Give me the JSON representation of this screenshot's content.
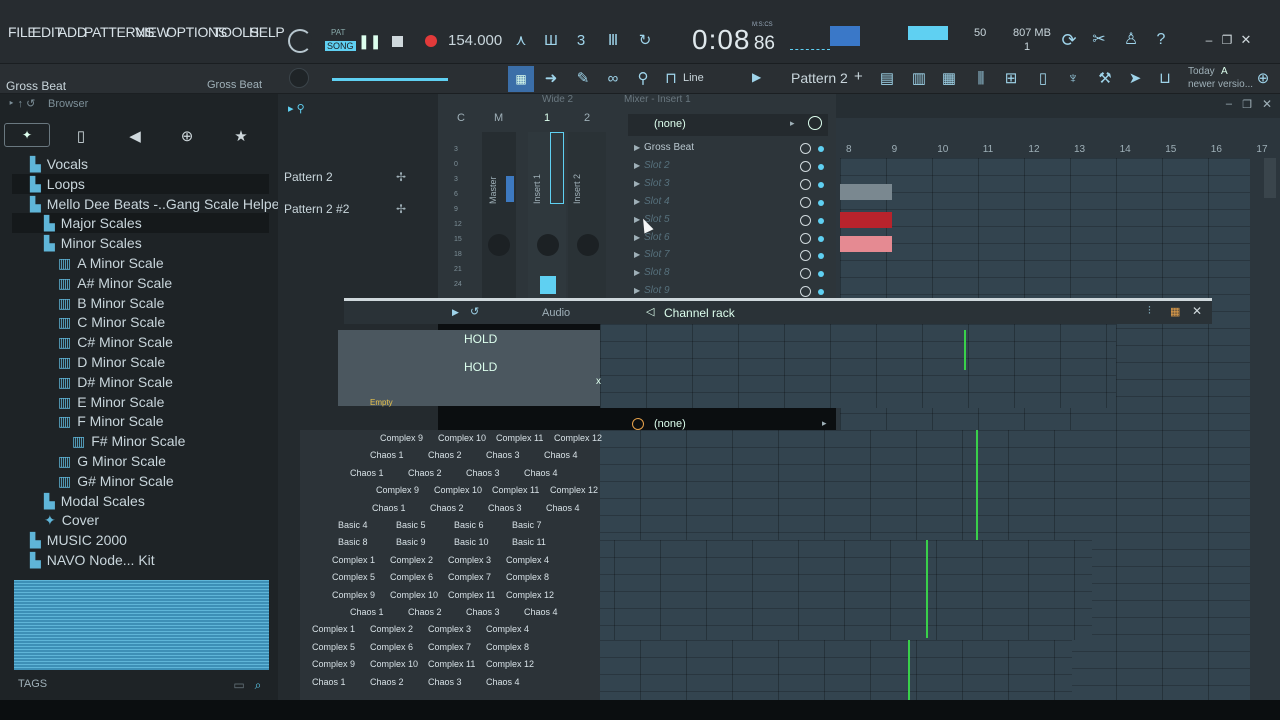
{
  "menu": [
    "FILE",
    "EDIT",
    "ADD",
    "PATTERNS",
    "VIEW",
    "OPTIONS",
    "TOOLS",
    "HELP"
  ],
  "transport": {
    "mode_pat": "PAT",
    "mode_song": "SONG",
    "tempo": "154.000",
    "time": "0:08",
    "time_sub": "86",
    "time_unit": "M:S:CS",
    "cpu_value": "50",
    "memory": "807 MB",
    "voices": "1"
  },
  "hint": {
    "left": "Gross Beat",
    "right": "Gross Beat"
  },
  "toolbar2": {
    "snap": "Line",
    "pattern": "Pattern 2",
    "news_date": "Today",
    "news_letter": "A",
    "news_text": "newer versio..."
  },
  "browser": {
    "title": "Browser",
    "items": [
      {
        "label": "Vocals",
        "indent": 1,
        "icon": "folder"
      },
      {
        "label": "Loops",
        "indent": 1,
        "icon": "folder"
      },
      {
        "label": "Mello Dee Beats -..Gang Scale Helpers",
        "indent": 1,
        "icon": "folder"
      },
      {
        "label": "Major Scales",
        "indent": 2,
        "icon": "folder"
      },
      {
        "label": "Minor Scales",
        "indent": 2,
        "icon": "folder"
      },
      {
        "label": "A Minor Scale",
        "indent": 3,
        "icon": "piano"
      },
      {
        "label": "A# Minor Scale",
        "indent": 3,
        "icon": "piano"
      },
      {
        "label": "B Minor Scale",
        "indent": 3,
        "icon": "piano"
      },
      {
        "label": "C Minor Scale",
        "indent": 3,
        "icon": "piano"
      },
      {
        "label": "C# Minor Scale",
        "indent": 3,
        "icon": "piano"
      },
      {
        "label": "D Minor Scale",
        "indent": 3,
        "icon": "piano"
      },
      {
        "label": "D# Minor Scale",
        "indent": 3,
        "icon": "piano"
      },
      {
        "label": "E Minor Scale",
        "indent": 3,
        "icon": "piano"
      },
      {
        "label": "F Minor Scale",
        "indent": 3,
        "icon": "piano"
      },
      {
        "label": "F# Minor Scale",
        "indent": 4,
        "icon": "piano"
      },
      {
        "label": "G Minor Scale",
        "indent": 3,
        "icon": "piano"
      },
      {
        "label": "G# Minor Scale",
        "indent": 3,
        "icon": "piano"
      },
      {
        "label": "Modal Scales",
        "indent": 2,
        "icon": "folder"
      },
      {
        "label": "Cover",
        "indent": 2,
        "icon": "pin"
      },
      {
        "label": "MUSIC 2000",
        "indent": 1,
        "icon": "folder"
      },
      {
        "label": "NAVO Node... Kit",
        "indent": 1,
        "icon": "folder"
      }
    ],
    "tags_label": "TAGS"
  },
  "patterns": [
    "Pattern 2",
    "Pattern 2 #2"
  ],
  "mixer": {
    "title": "Mixer - Insert 1",
    "wide": "Wide 2",
    "cols": [
      "C",
      "M",
      "1",
      "2"
    ],
    "tracks": [
      "Master",
      "Insert 1",
      "Insert 2"
    ],
    "none_label": "(none)",
    "slots": [
      "Gross Beat",
      "Slot 2",
      "Slot 3",
      "Slot 4",
      "Slot 5",
      "Slot 6",
      "Slot 7",
      "Slot 8",
      "Slot 9"
    ],
    "vu_marks": [
      "3",
      "0",
      "3",
      "6",
      "9",
      "12",
      "15",
      "18",
      "21",
      "24"
    ]
  },
  "playlist": {
    "bars": [
      "8",
      "9",
      "10",
      "11",
      "12",
      "13",
      "14",
      "15",
      "16",
      "17"
    ]
  },
  "channel_rack": {
    "title": "Channel rack",
    "filter": "Audio",
    "none_label": "(none)",
    "hold": "HOLD",
    "empty": "Empty",
    "close": "x"
  },
  "presets": [
    [
      "Complex 9",
      "Complex 10",
      "Complex 11",
      "Complex 12"
    ],
    [
      "Chaos 1",
      "Chaos 2",
      "Chaos 3",
      "Chaos 4"
    ],
    [
      "Chaos 1",
      "Chaos 2",
      "Chaos 3",
      "Chaos 4"
    ],
    [
      "Complex 9",
      "Complex 10",
      "Complex 11",
      "Complex 12"
    ],
    [
      "Chaos 1",
      "Chaos 2",
      "Chaos 3",
      "Chaos 4"
    ],
    [
      "Basic 4",
      "Basic 5",
      "Basic 6",
      "Basic 7"
    ],
    [
      "Basic 8",
      "Basic 9",
      "Basic 10",
      "Basic 11"
    ],
    [
      "Complex 1",
      "Complex 2",
      "Complex 3",
      "Complex 4"
    ],
    [
      "Complex 5",
      "Complex 6",
      "Complex 7",
      "Complex 8"
    ],
    [
      "Complex 9",
      "Complex 10",
      "Complex 11",
      "Complex 12"
    ],
    [
      "Chaos 1",
      "Chaos 2",
      "Chaos 3",
      "Chaos 4"
    ],
    [
      "Complex 1",
      "Complex 2",
      "Complex 3",
      "Complex 4"
    ],
    [
      "Complex 5",
      "Complex 6",
      "Complex 7",
      "Complex 8"
    ],
    [
      "Complex 9",
      "Complex 10",
      "Complex 11",
      "Complex 12"
    ],
    [
      "Chaos 1",
      "Chaos 2",
      "Chaos 3",
      "Chaos 4"
    ]
  ],
  "colors": {
    "accent": "#5fd0f2",
    "record": "#e23a3a",
    "green": "#39d04a",
    "clip_red": "#b8232c",
    "clip_pink": "#e58a92"
  }
}
